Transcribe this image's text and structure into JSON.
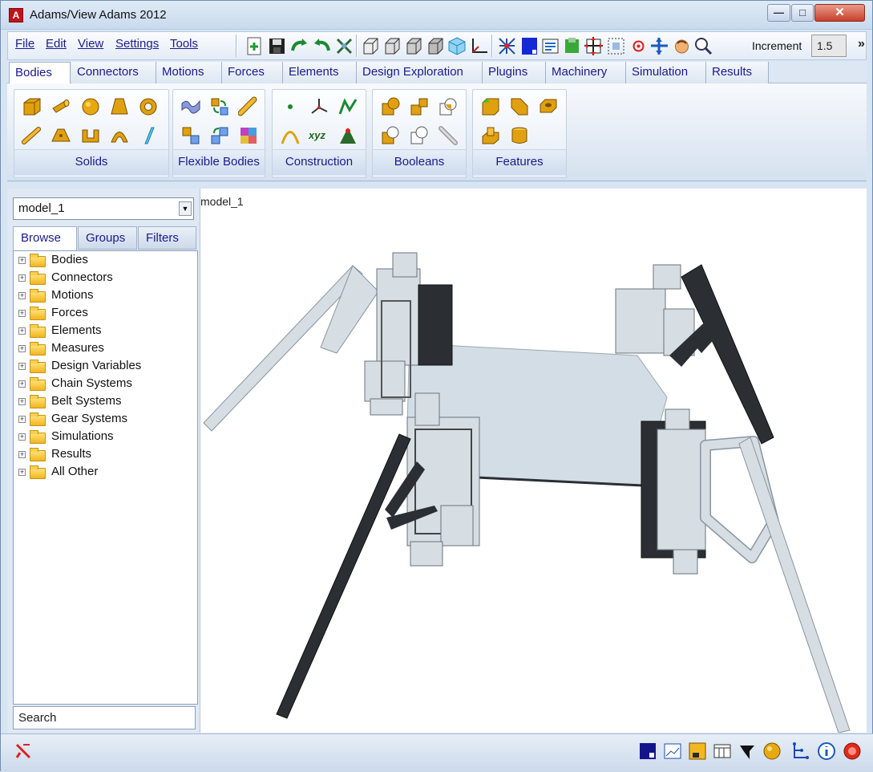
{
  "window": {
    "title": "Adams/View Adams 2012",
    "logo_letter": "A"
  },
  "menu": {
    "items": [
      "File",
      "Edit",
      "View",
      "Settings",
      "Tools"
    ]
  },
  "toolbar": {
    "increment_label": "Increment",
    "increment_value": "1.5",
    "overflow": "»"
  },
  "tabs": [
    "Bodies",
    "Connectors",
    "Motions",
    "Forces",
    "Elements",
    "Design Exploration",
    "Plugins",
    "Machinery",
    "Simulation",
    "Results"
  ],
  "ribbon": {
    "groups": [
      "Solids",
      "Flexible Bodies",
      "Construction",
      "Booleans",
      "Features"
    ],
    "construction_xyz": "xyz"
  },
  "browser": {
    "model_select": "model_1",
    "tabs": [
      "Browse",
      "Groups",
      "Filters"
    ],
    "tree": [
      "Bodies",
      "Connectors",
      "Motions",
      "Forces",
      "Elements",
      "Measures",
      "Design Variables",
      "Chain Systems",
      "Belt Systems",
      "Gear Systems",
      "Simulations",
      "Results",
      "All Other"
    ],
    "search_placeholder": "Search"
  },
  "viewport": {
    "model_label": "model_1"
  },
  "colors": {
    "accent": "#1a1a8c",
    "part_light": "#d6dde3",
    "part_dark": "#2b2f34",
    "platform": "#d3dde5"
  }
}
